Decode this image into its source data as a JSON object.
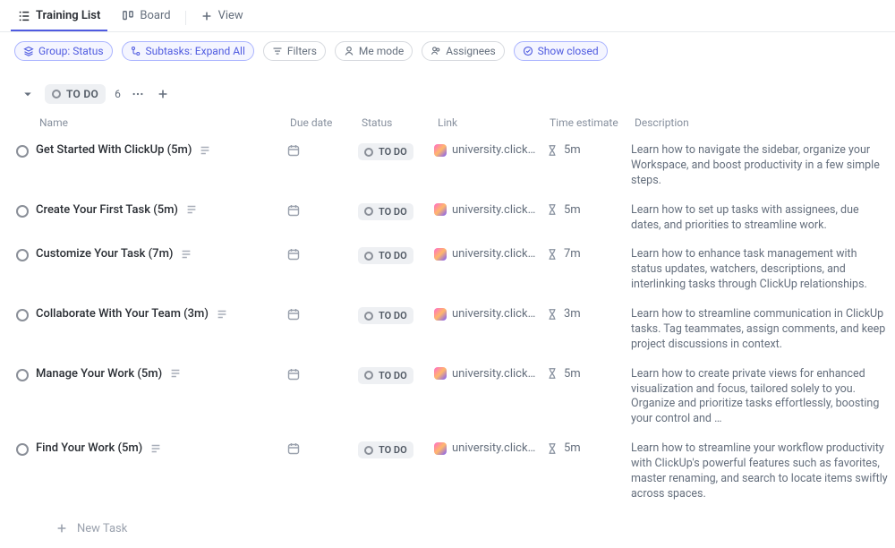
{
  "views": {
    "list": {
      "label": "Training List"
    },
    "board": {
      "label": "Board"
    },
    "add": {
      "label": "View"
    }
  },
  "filters": {
    "group": "Group: Status",
    "subtasks": "Subtasks: Expand All",
    "filters": "Filters",
    "me_mode": "Me mode",
    "assignees": "Assignees",
    "show_closed": "Show closed"
  },
  "group": {
    "status_label": "TO DO",
    "count": "6"
  },
  "columns": {
    "name": "Name",
    "due": "Due date",
    "status": "Status",
    "link": "Link",
    "time": "Time estimate",
    "desc": "Description"
  },
  "status_pill": "TO DO",
  "link_text": "university.click…",
  "tasks": [
    {
      "name": "Get Started With ClickUp (5m)",
      "time": "5m",
      "description": "Learn how to navigate the sidebar, organize your Workspace, and boost productivity in a few simple steps."
    },
    {
      "name": "Create Your First Task (5m)",
      "time": "5m",
      "description": "Learn how to set up tasks with assignees, due dates, and priorities to streamline work."
    },
    {
      "name": "Customize Your Task (7m)",
      "time": "7m",
      "description": "Learn how to enhance task management with status updates, watchers, descriptions, and interlinking tasks through ClickUp relationships."
    },
    {
      "name": "Collaborate With Your Team (3m)",
      "time": "3m",
      "description": "Learn how to streamline communication in ClickUp tasks. Tag teammates, assign comments, and keep project discussions in context."
    },
    {
      "name": "Manage Your Work (5m)",
      "time": "5m",
      "description": "Learn how to create private views for enhanced visualization and focus, tailored solely to you. Organize and prioritize tasks effortlessly, boosting your control and …"
    },
    {
      "name": "Find Your Work (5m)",
      "time": "5m",
      "description": "Learn how to streamline your workflow productivity with ClickUp's powerful features such as favorites, master renaming, and search to locate items swiftly across spaces."
    }
  ],
  "new_task": "New Task"
}
